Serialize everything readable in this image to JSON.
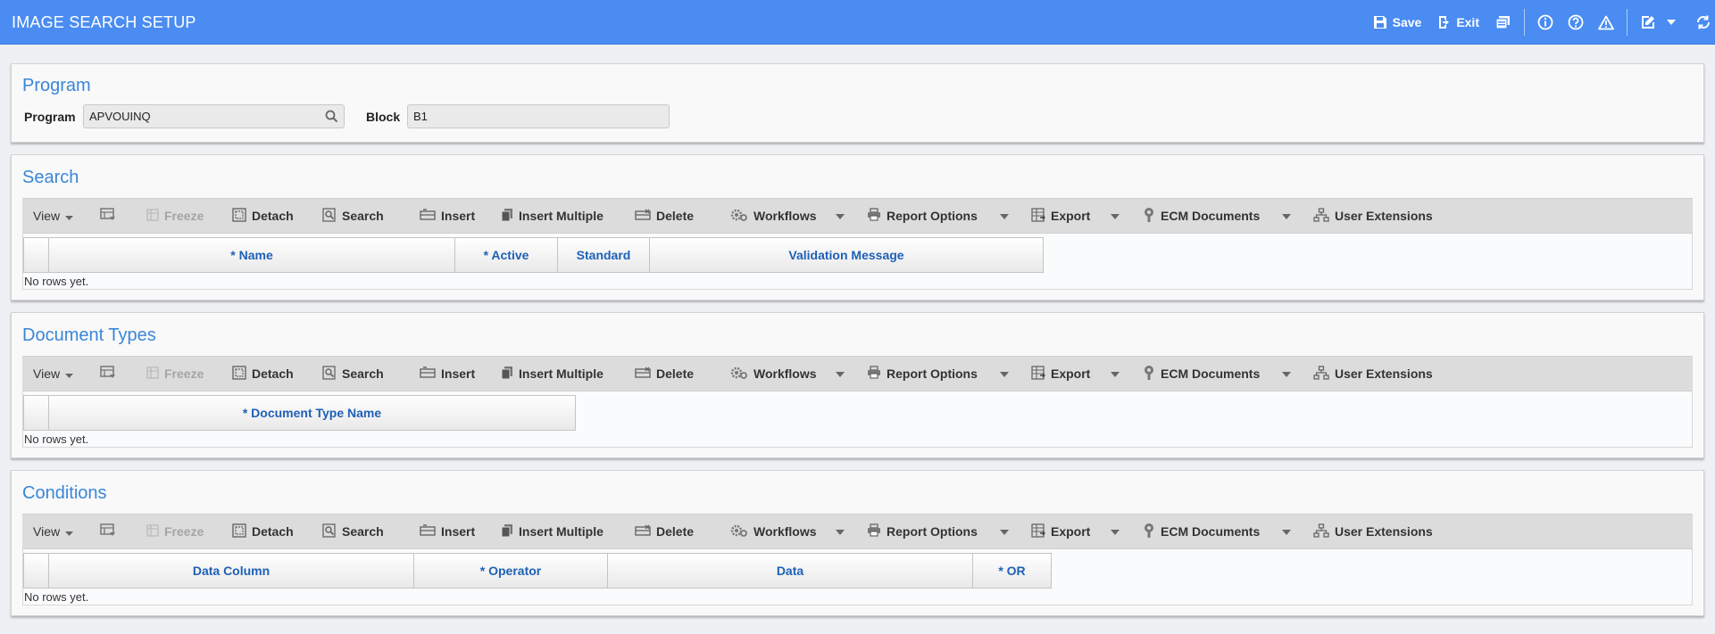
{
  "header": {
    "title": "IMAGE SEARCH SETUP",
    "save_label": "Save",
    "exit_label": "Exit"
  },
  "program_panel": {
    "title": "Program",
    "program_label": "Program",
    "program_value": "APVOUINQ",
    "block_label": "Block",
    "block_value": "B1"
  },
  "toolbar": {
    "view": "View",
    "freeze": "Freeze",
    "detach": "Detach",
    "search": "Search",
    "insert": "Insert",
    "insert_multiple": "Insert Multiple",
    "delete": "Delete",
    "workflows": "Workflows",
    "report_options": "Report Options",
    "export": "Export",
    "ecm_documents": "ECM Documents",
    "user_extensions": "User Extensions"
  },
  "search_panel": {
    "title": "Search",
    "columns": [
      "* Name",
      "* Active",
      "Standard",
      "Validation Message"
    ],
    "empty_text": "No rows yet."
  },
  "document_types_panel": {
    "title": "Document Types",
    "columns": [
      "* Document Type Name"
    ],
    "empty_text": "No rows yet."
  },
  "conditions_panel": {
    "title": "Conditions",
    "columns": [
      "Data Column",
      "* Operator",
      "Data",
      "* OR"
    ],
    "empty_text": "No rows yet."
  },
  "colors": {
    "header_bg": "#4a8cf2",
    "panel_title": "#3a86d8",
    "column_header_text": "#1e60b7",
    "toolbar_bg": "#dcdcdc"
  },
  "icons": [
    "save-icon",
    "exit-icon",
    "print-icon",
    "info-icon",
    "help-icon",
    "warning-icon",
    "edit-icon",
    "chevron-down-icon",
    "refresh-icon",
    "search-icon"
  ]
}
